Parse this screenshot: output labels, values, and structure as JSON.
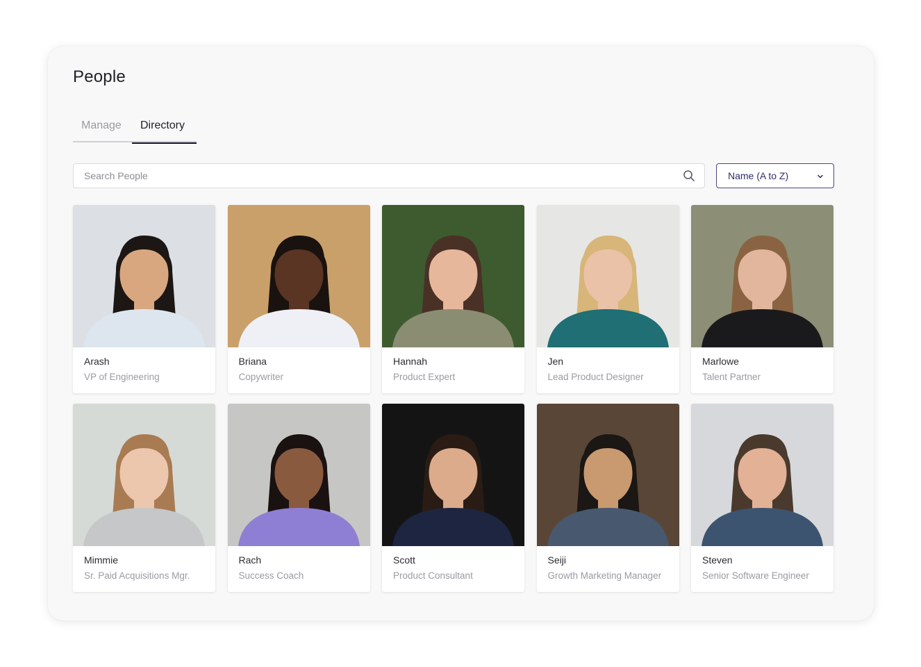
{
  "page": {
    "title": "People"
  },
  "tabs": [
    {
      "label": "Manage",
      "active": false
    },
    {
      "label": "Directory",
      "active": true
    }
  ],
  "search": {
    "placeholder": "Search People",
    "value": ""
  },
  "sort": {
    "selected": "Name (A to Z)"
  },
  "colors": {
    "accent": "#2f2c6b",
    "tab_underline": "#15152a",
    "panel": "#f8f8f8"
  },
  "people": [
    {
      "name": "Arash",
      "title": "VP of Engineering",
      "photo": {
        "bg": "#dcdfe4",
        "skin": "#d9a77f",
        "hair": "#1c1714",
        "shirt": "#dde6ef"
      }
    },
    {
      "name": "Briana",
      "title": "Copywriter",
      "photo": {
        "bg": "#c9a06a",
        "skin": "#5a3524",
        "hair": "#1a120e",
        "shirt": "#eef0f5"
      }
    },
    {
      "name": "Hannah",
      "title": "Product Expert",
      "photo": {
        "bg": "#3d5b2f",
        "skin": "#e7b79c",
        "hair": "#4a3126",
        "shirt": "#8b8d73"
      }
    },
    {
      "name": "Jen",
      "title": "Lead Product Designer",
      "photo": {
        "bg": "#e6e6e4",
        "skin": "#eac2a8",
        "hair": "#d8b578",
        "shirt": "#1f6f74"
      }
    },
    {
      "name": "Marlowe",
      "title": "Talent Partner",
      "photo": {
        "bg": "#8c8f76",
        "skin": "#e2b69c",
        "hair": "#8a6442",
        "shirt": "#1a1a1c"
      }
    },
    {
      "name": "Mimmie",
      "title": "Sr. Paid Acquisitions Mgr.",
      "photo": {
        "bg": "#d6dad6",
        "skin": "#ecc6ad",
        "hair": "#a97b52",
        "shirt": "#c5c7c9"
      }
    },
    {
      "name": "Rach",
      "title": "Success Coach",
      "photo": {
        "bg": "#c6c6c4",
        "skin": "#8a5a3f",
        "hair": "#1a1210",
        "shirt": "#8e7fd4"
      }
    },
    {
      "name": "Scott",
      "title": "Product Consultant",
      "photo": {
        "bg": "#141414",
        "skin": "#dcab8c",
        "hair": "#2a1c14",
        "shirt": "#1d2540"
      }
    },
    {
      "name": "Seiji",
      "title": "Growth Marketing Manager",
      "photo": {
        "bg": "#5a4636",
        "skin": "#c9996f",
        "hair": "#1a1714",
        "shirt": "#48586f"
      }
    },
    {
      "name": "Steven",
      "title": "Senior Software Engineer",
      "photo": {
        "bg": "#d7d8db",
        "skin": "#e3b196",
        "hair": "#4a3a2e",
        "shirt": "#3c5470"
      }
    }
  ]
}
